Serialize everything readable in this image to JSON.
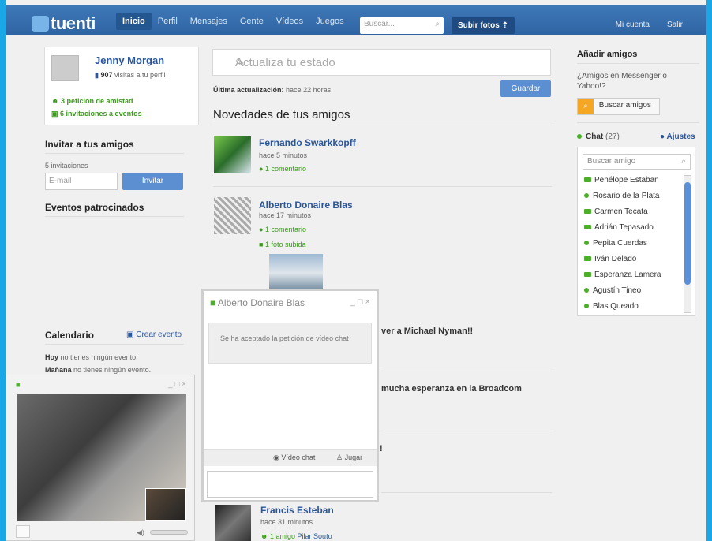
{
  "header": {
    "logo": "tuenti",
    "nav": [
      "Inicio",
      "Perfil",
      "Mensajes",
      "Gente",
      "Vídeos",
      "Juegos"
    ],
    "search_placeholder": "Buscar...",
    "upload": "Subir fotos",
    "my_account": "Mi cuenta",
    "logout": "Salir"
  },
  "profile": {
    "name": "Jenny Morgan",
    "visits_count": "907",
    "visits_label": "visitas a tu perfil",
    "friend_requests": "3 petición de amistad",
    "event_invites": "6 invitaciones a eventos"
  },
  "invite": {
    "title": "Invitar a tus amigos",
    "count": "5 invitaciones",
    "email_placeholder": "E-mail",
    "button": "Invitar"
  },
  "sponsored": {
    "title": "Eventos patrocinados"
  },
  "calendar": {
    "title": "Calendario",
    "create": "Crear evento",
    "today_bold": "Hoy",
    "today_text": "no tienes ningún evento.",
    "tomorrow_bold": "Mañana",
    "tomorrow_text": "no tienes ningún evento."
  },
  "status": {
    "placeholder": "Actualiza tu estado",
    "last_update_label": "Última actualización:",
    "last_update_value": "hace 22 horas",
    "save": "Guardar"
  },
  "feed": {
    "title": "Novedades de tus amigos",
    "items": [
      {
        "name": "Fernando Swarkkopff",
        "time": "hace 5 minutos",
        "extra1": "1 comentario",
        "extra2": ""
      },
      {
        "name": "Alberto Donaire Blas",
        "time": "hace 17 minutos",
        "extra1": "1 comentario",
        "extra2": "1 foto subida"
      },
      {
        "name": "Francis Esteban",
        "time": "hace 31 minutos",
        "extra1": "1 amigo",
        "extra2": "Pilar Souto"
      }
    ],
    "hidden_1": "ver a Michael Nyman!!",
    "hidden_2": "mucha esperanza en la Broadcom",
    "hidden_3": "!"
  },
  "right": {
    "add_friends_title": "Añadir amigos",
    "add_friends_text": "¿Amigos en Messenger o Yahoo!?",
    "search_friends": "Buscar amigos",
    "chat_label": "Chat",
    "chat_count": "(27)",
    "settings": "Ajustes",
    "chat_search_placeholder": "Buscar amigo",
    "friends": [
      {
        "name": "Penélope Estaban",
        "cam": true
      },
      {
        "name": "Rosario de la Plata",
        "cam": false
      },
      {
        "name": "Carmen Tecata",
        "cam": true
      },
      {
        "name": "Adrián Tepasado",
        "cam": true
      },
      {
        "name": "Pepita Cuerdas",
        "cam": false
      },
      {
        "name": "Iván Delado",
        "cam": true
      },
      {
        "name": "Esperanza Lamera",
        "cam": true
      },
      {
        "name": "Agustín Tineo",
        "cam": false
      },
      {
        "name": "Blas Queado",
        "cam": false
      }
    ]
  },
  "video_chat": {
    "title": "Alberto Donaire Blas",
    "message": "Se ha aceptado la petición de vídeo chat",
    "video_button": "Vídeo chat",
    "play_button": "Jugar",
    "window_controls": "_ □ ×"
  },
  "colors": {
    "brand": "#3f79b8",
    "link": "#2a5599",
    "green": "#3d9a1e",
    "bg": "#1aa7e8"
  }
}
